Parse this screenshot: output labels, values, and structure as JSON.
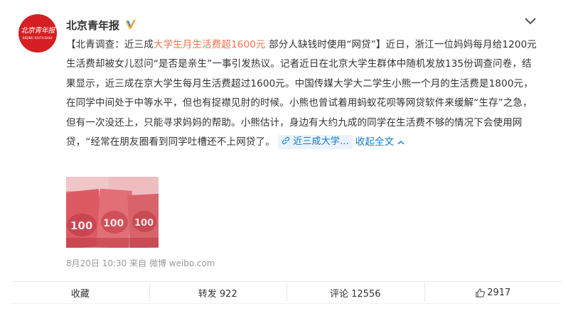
{
  "post": {
    "avatar_text": "北京青年报",
    "avatar_subtext": "BEIJING YOUTH DAILY",
    "username": "北京青年报",
    "body_prefix": "【北青调查：近三成",
    "body_highlight": "大学生月生活费超1600元",
    "body_rest": " 部分人缺钱时使用“网贷”】近日，浙江一位妈妈每月给1200元生活费却被女儿怼问“是否是亲生”一事引发热议。记者近日在北京大学生群体中随机发放135份调查问卷，结果显示，近三成在京大学生每月生活费超过1600元。中国传媒大学大二学生小熊一个月的生活费是1800元，在同学中间处于中等水平，但也有捉襟见肘的时候。小熊也曾试着用蚂蚁花呗等网贷软件来缓解“生存”之急，但有一次没还上，只能寻求妈妈的帮助。小熊估计，身边有大约九成的同学在生活费不够的情况下会使用网贷，“经常在朋友圈看到同学吐槽还不上网贷了。",
    "link_tag": "近三成大学...",
    "collapse_label": "收起全文",
    "timestamp": "8月20日 10:30",
    "source": "来自 微博 weibo.com"
  },
  "actions": {
    "favorite": "收藏",
    "repost": "转发 922",
    "comment": "评论 12556",
    "like": "2917"
  },
  "colors": {
    "accent_link": "#0e7bc9",
    "highlight": "#eb7350",
    "brand_red": "#d51f22"
  }
}
